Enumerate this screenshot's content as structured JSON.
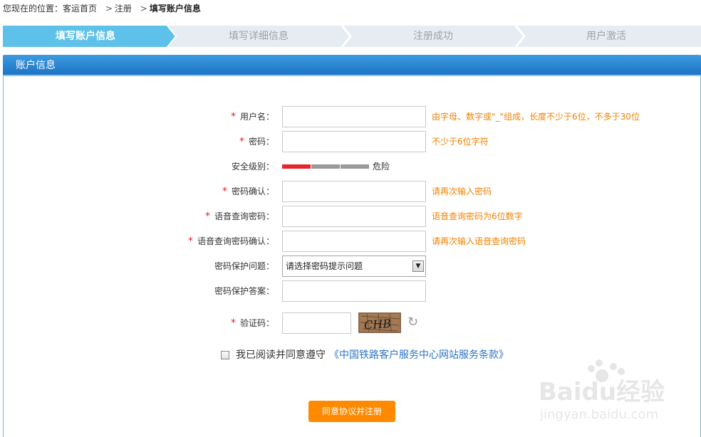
{
  "breadcrumb": {
    "prefix": "您现在的位置：",
    "home": "客运首页",
    "sep": ">",
    "register": "注册",
    "current": "填写账户信息"
  },
  "steps": [
    {
      "label": "填写账户信息",
      "active": true
    },
    {
      "label": "填写详细信息",
      "active": false
    },
    {
      "label": "注册成功",
      "active": false
    },
    {
      "label": "用户激活",
      "active": false
    }
  ],
  "panel": {
    "title": "账户信息"
  },
  "form": {
    "required_mark": "*",
    "username": {
      "label": "用户名：",
      "value": "",
      "hint": "由字母、数字或\"_\"组成，长度不少于6位，不多于30位"
    },
    "password": {
      "label": "密码：",
      "value": "",
      "hint": "不少于6位字符"
    },
    "security": {
      "label": "安全级别：",
      "level_text": "危险",
      "level": 1,
      "levels": 3
    },
    "password_confirm": {
      "label": "密码确认：",
      "value": "",
      "hint": "请再次输入密码"
    },
    "voice_pwd": {
      "label": "语音查询密码：",
      "value": "",
      "hint": "语音查询密码为6位数字"
    },
    "voice_pwd_confirm": {
      "label": "语音查询密码确认：",
      "value": "",
      "hint": "请再次输入语音查询密码"
    },
    "pwd_question": {
      "label": "密码保护问题：",
      "selected": "请选择密码提示问题"
    },
    "pwd_answer": {
      "label": "密码保护答案：",
      "value": ""
    },
    "captcha": {
      "label": "验证码：",
      "value": "",
      "image_text": "CHB"
    },
    "agree": {
      "text": "我已阅读并同意遵守",
      "link": "《中国铁路客户服务中心网站服务条款》",
      "checked": false
    },
    "submit_label": "同意协议并注册"
  },
  "colors": {
    "step_active": "#5ec1ea",
    "step_inactive": "#e6edf2",
    "hint": "#f08200",
    "required": "#e5252b",
    "strength_active": "#e5252b",
    "submit": "#ff8a00",
    "link": "#2b73c5"
  },
  "icons": {
    "refresh": "refresh-icon",
    "dropdown": "chevron-down-icon"
  },
  "watermark": {
    "brand": "Baidu经验",
    "url": "jingyan.baidu.com"
  }
}
